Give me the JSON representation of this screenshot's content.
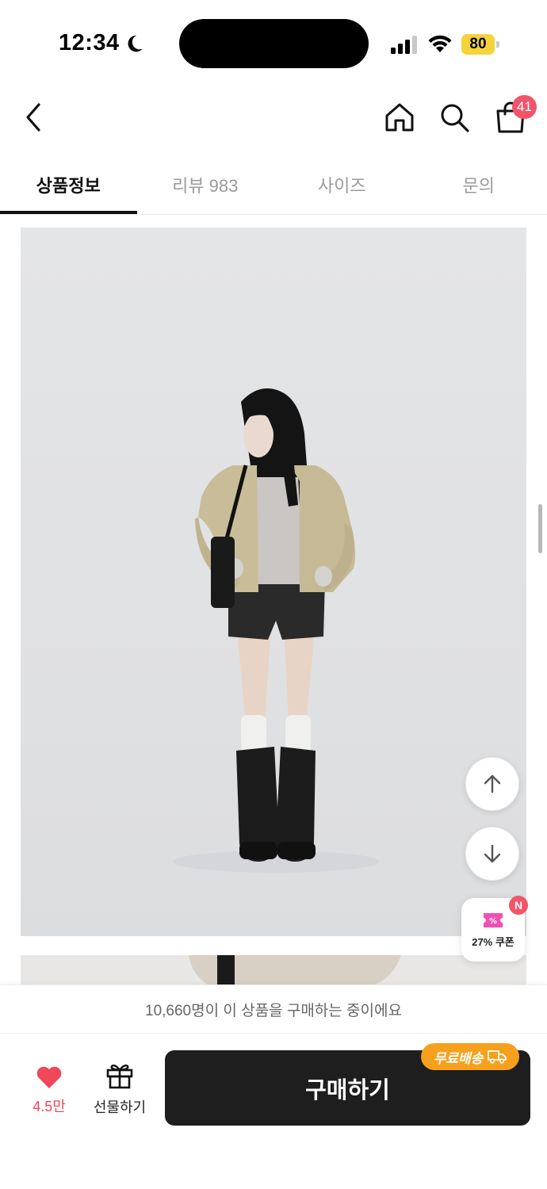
{
  "status_bar": {
    "time": "12:34",
    "battery": "80"
  },
  "nav": {
    "cart_count": "41"
  },
  "tabs": [
    {
      "label": "상품정보",
      "active": true
    },
    {
      "label": "리뷰 983",
      "active": false
    },
    {
      "label": "사이즈",
      "active": false
    },
    {
      "label": "문의",
      "active": false
    }
  ],
  "floating": {
    "coupon_label": "27% 쿠폰",
    "coupon_badge": "N"
  },
  "purchase_notice": "10,660명이 이 상품을 구매하는 중이에요",
  "bottom": {
    "like_count": "4.5만",
    "gift_label": "선물하기",
    "buy_label": "구매하기",
    "free_shipping_label": "무료배송"
  },
  "colors": {
    "accent_red": "#f0475b",
    "badge_red": "#f2556a",
    "button_dark": "#1e1e1e",
    "shipping_orange": "#f7a01d",
    "battery_yellow": "#f5d33b"
  },
  "icons": [
    "moon-icon",
    "signal-icon",
    "wifi-icon",
    "back-icon",
    "home-icon",
    "search-icon",
    "shopping-bag-icon",
    "arrow-up-icon",
    "arrow-down-icon",
    "coupon-icon",
    "heart-icon",
    "gift-icon",
    "truck-icon"
  ]
}
